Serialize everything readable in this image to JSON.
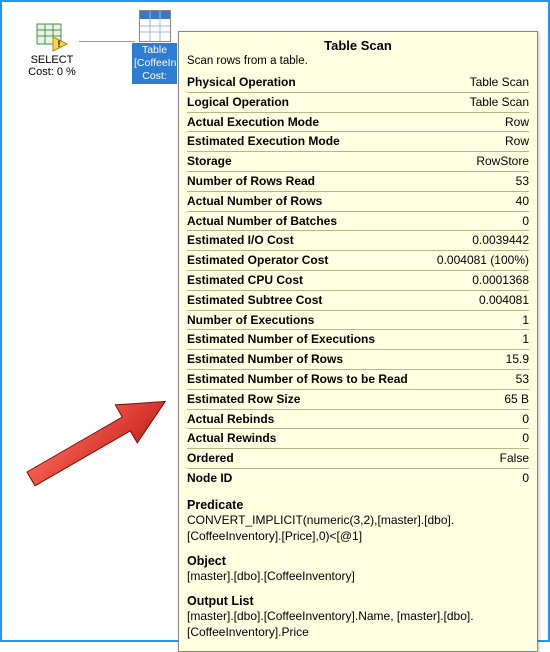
{
  "plan": {
    "select": {
      "label": "SELECT",
      "cost": "Cost: 0 %"
    },
    "table": {
      "line1": "Table",
      "line2": "[CoffeeIn",
      "line3": "Cost:"
    }
  },
  "tooltip": {
    "title": "Table Scan",
    "subtitle": "Scan rows from a table.",
    "props": [
      {
        "k": "Physical Operation",
        "v": "Table Scan"
      },
      {
        "k": "Logical Operation",
        "v": "Table Scan"
      },
      {
        "k": "Actual Execution Mode",
        "v": "Row"
      },
      {
        "k": "Estimated Execution Mode",
        "v": "Row"
      },
      {
        "k": "Storage",
        "v": "RowStore"
      },
      {
        "k": "Number of Rows Read",
        "v": "53"
      },
      {
        "k": "Actual Number of Rows",
        "v": "40"
      },
      {
        "k": "Actual Number of Batches",
        "v": "0"
      },
      {
        "k": "Estimated I/O Cost",
        "v": "0.0039442"
      },
      {
        "k": "Estimated Operator Cost",
        "v": "0.004081 (100%)"
      },
      {
        "k": "Estimated CPU Cost",
        "v": "0.0001368"
      },
      {
        "k": "Estimated Subtree Cost",
        "v": "0.004081"
      },
      {
        "k": "Number of Executions",
        "v": "1"
      },
      {
        "k": "Estimated Number of Executions",
        "v": "1"
      },
      {
        "k": "Estimated Number of Rows",
        "v": "15.9"
      },
      {
        "k": "Estimated Number of Rows to be Read",
        "v": "53"
      },
      {
        "k": "Estimated Row Size",
        "v": "65 B"
      },
      {
        "k": "Actual Rebinds",
        "v": "0"
      },
      {
        "k": "Actual Rewinds",
        "v": "0"
      },
      {
        "k": "Ordered",
        "v": "False"
      },
      {
        "k": "Node ID",
        "v": "0"
      }
    ],
    "predicate": {
      "label": "Predicate",
      "body": "CONVERT_IMPLICIT(numeric(3,2),[master].[dbo].[CoffeeInventory].[Price],0)<[@1]"
    },
    "object": {
      "label": "Object",
      "body": "[master].[dbo].[CoffeeInventory]"
    },
    "output": {
      "label": "Output List",
      "body": "[master].[dbo].[CoffeeInventory].Name, [master].[dbo].[CoffeeInventory].Price"
    }
  }
}
